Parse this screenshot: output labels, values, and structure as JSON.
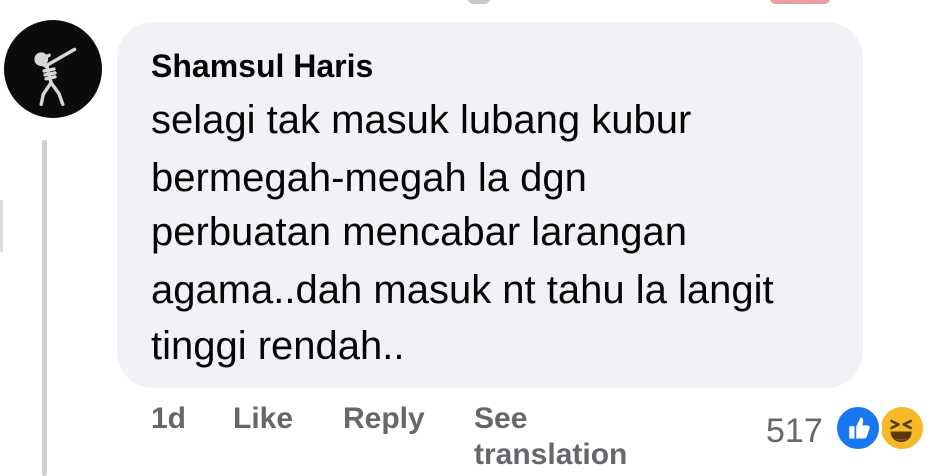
{
  "comment": {
    "author": "Shamsul Haris",
    "text_lines": [
      "selagi tak masuk lubang kubur",
      "bermegah-megah la dgn",
      "perbuatan mencabar larangan",
      "agama..dah masuk nt tahu la langit",
      "tinggi rendah.."
    ],
    "time": "1d",
    "like_label": "Like",
    "reply_label": "Reply",
    "see_translation_line1": "See",
    "see_translation_line2": "translation",
    "reaction_count": "517",
    "reactions": [
      "like-icon",
      "haha-icon"
    ]
  },
  "colors": {
    "bubble": "#f0f2f5",
    "text": "#050505",
    "secondary_text": "#65676b",
    "like_blue": "#1877f2",
    "haha_yellow": "#f7b928",
    "thread_line": "#ccd0d5"
  }
}
